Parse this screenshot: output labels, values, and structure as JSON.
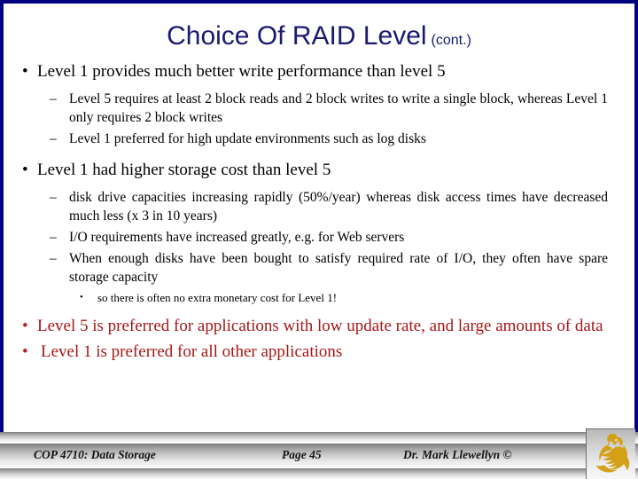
{
  "slide": {
    "title_main": "Choice Of RAID Level",
    "title_cont": "(cont.)",
    "title_color": "#191970",
    "accent_border_color": "#000080",
    "body_text_color": "#000000",
    "highlight_text_color": "#a81616",
    "logo_color": "#D4A017",
    "bullets": {
      "level1_glyph": "•",
      "level2_glyph": "–",
      "level3_glyph": "•"
    },
    "content": [
      {
        "level": 1,
        "color": "black",
        "text": "Level 1 provides much better write performance than level 5"
      },
      {
        "level": 2,
        "color": "black",
        "text": "Level 5 requires at least 2 block reads and 2 block writes to write a single block, whereas Level 1 only requires 2 block writes"
      },
      {
        "level": 2,
        "color": "black",
        "text": "Level 1 preferred for high update environments such as log disks"
      },
      {
        "level": 1,
        "color": "black",
        "text": "Level 1 had higher storage cost than level 5"
      },
      {
        "level": 2,
        "color": "black",
        "text": "disk drive capacities increasing rapidly (50%/year) whereas disk access times have decreased much less (x 3 in 10 years)"
      },
      {
        "level": 2,
        "color": "black",
        "text": "I/O requirements have increased greatly, e.g. for Web servers"
      },
      {
        "level": 2,
        "color": "black",
        "text": "When enough disks have been bought to satisfy required rate of I/O, they often have spare storage capacity"
      },
      {
        "level": 3,
        "color": "black",
        "text": "so there is often no extra monetary cost for Level 1!"
      },
      {
        "level": 1,
        "color": "red",
        "text": "Level 5 is preferred for applications with low update rate, and large amounts of data"
      },
      {
        "level": 1,
        "color": "red",
        "text": "Level 1 is preferred for all other applications"
      }
    ]
  },
  "footer": {
    "course": "COP 4710: Data Storage",
    "page": "Page 45",
    "author": "Dr. Mark Llewellyn ©",
    "logo_name": "ucf-pegasus-logo"
  }
}
